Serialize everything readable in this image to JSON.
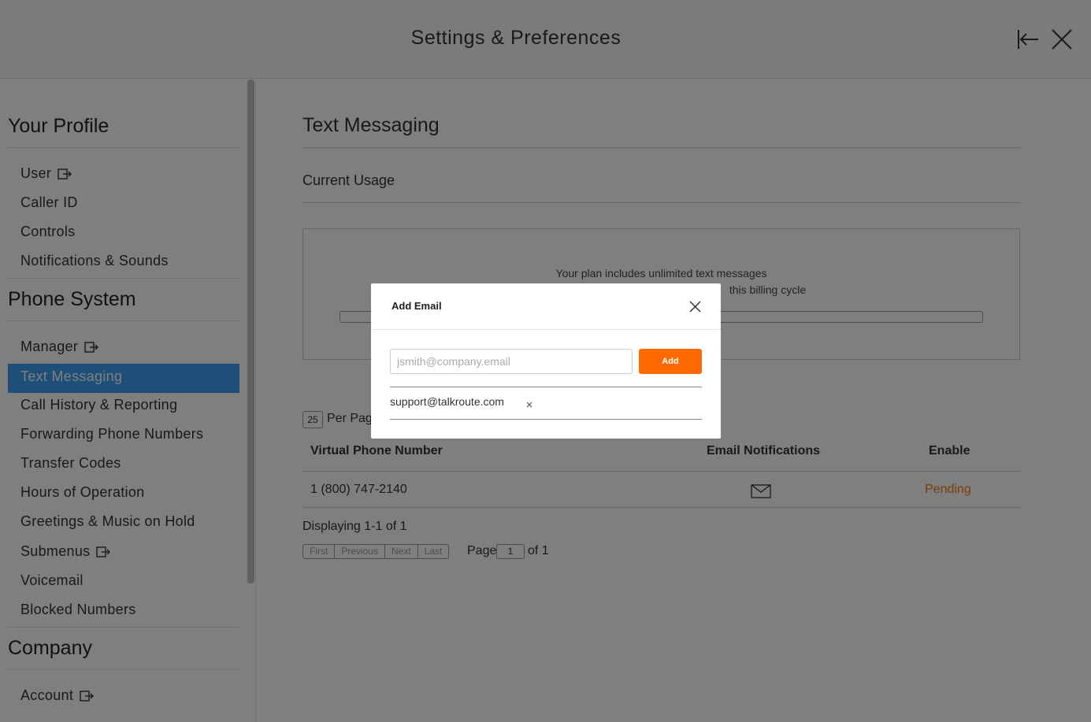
{
  "header": {
    "title": "Settings & Preferences"
  },
  "sidebar": {
    "sections": [
      {
        "title": "Your Profile"
      },
      {
        "title": "Phone System"
      },
      {
        "title": "Company"
      }
    ],
    "profile_items": [
      "User",
      "Caller ID",
      "Controls",
      "Notifications & Sounds"
    ],
    "phone_items": [
      "Manager",
      "Text Messaging",
      "Call History & Reporting",
      "Forwarding Phone Numbers",
      "Transfer Codes",
      "Hours of Operation",
      "Greetings & Music on Hold",
      "Submenus",
      "Voicemail",
      "Blocked Numbers"
    ],
    "company_items": [
      "Account"
    ],
    "active_item": "Text Messaging"
  },
  "main": {
    "title": "Text Messaging",
    "subhead": "Current Usage",
    "usage_line1": "Your plan includes unlimited text messages",
    "usage_line2": "this billing cycle",
    "per_page_value": "25",
    "per_page_label": "Per Page",
    "columns": [
      "Virtual Phone Number",
      "Email Notifications",
      "Enable"
    ],
    "rows": [
      {
        "number": "1 (800) 747-2140",
        "email_icon": "envelope-icon",
        "enable": "Pending"
      }
    ],
    "displaying": "Displaying 1-1 of 1",
    "pager": [
      "First",
      "Previous",
      "Next",
      "Last"
    ],
    "page_label": "Page",
    "page_value": "1",
    "page_of": "of 1",
    "accent_color": "#f07a1a"
  },
  "modal": {
    "title": "Add Email",
    "input_placeholder": "jsmith@company.email",
    "add_label": "Add",
    "emails": [
      "support@talkroute.com"
    ],
    "button_color": "#ff6a00"
  }
}
